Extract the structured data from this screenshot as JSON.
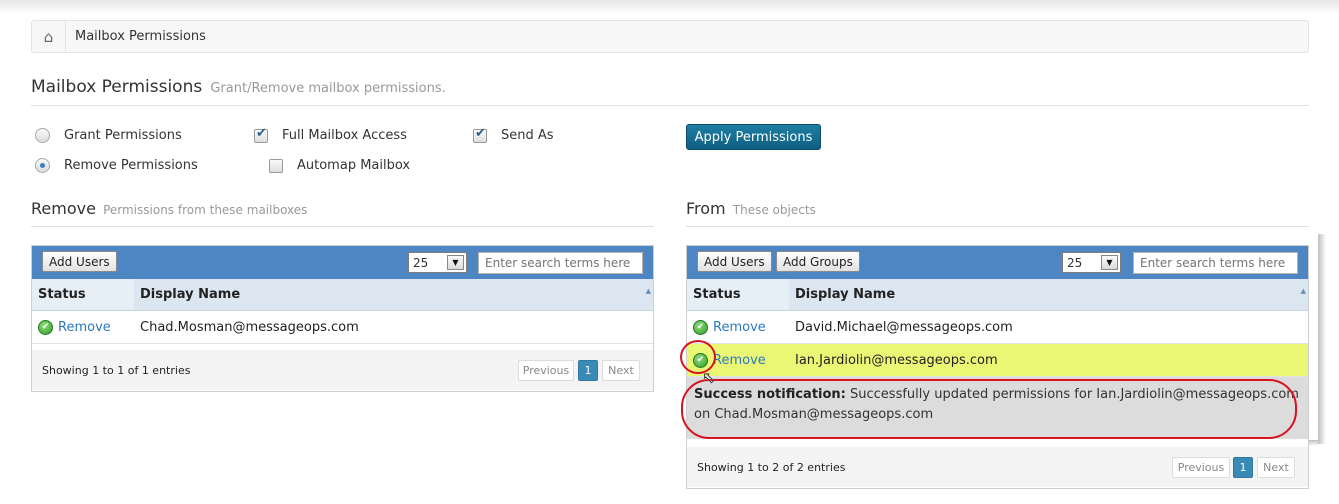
{
  "breadcrumb": {
    "home_icon": "home-icon",
    "current": "Mailbox Permissions"
  },
  "page": {
    "title": "Mailbox Permissions",
    "subtitle": "Grant/Remove mailbox permissions."
  },
  "options": {
    "grant_label": "Grant Permissions",
    "remove_label": "Remove Permissions",
    "full_access_label": "Full Mailbox Access",
    "automap_label": "Automap Mailbox",
    "send_as_label": "Send As",
    "selected_mode": "remove",
    "full_access_checked": true,
    "automap_checked": false,
    "send_as_checked": true
  },
  "apply_button": "Apply Permissions",
  "remove_section": {
    "title": "Remove",
    "subtitle": "Permissions from these mailboxes",
    "add_users": "Add Users",
    "page_size": "25",
    "search_placeholder": "Enter search terms here",
    "col_status": "Status",
    "col_name": "Display Name",
    "rows": [
      {
        "status": "Remove",
        "name": "Chad.Mosman@messageops.com"
      }
    ],
    "info": "Showing 1 to 1 of 1 entries",
    "prev": "Previous",
    "page": "1",
    "next": "Next"
  },
  "from_section": {
    "title": "From",
    "subtitle": "These objects",
    "add_users": "Add Users",
    "add_groups": "Add Groups",
    "page_size": "25",
    "search_placeholder": "Enter search terms here",
    "col_status": "Status",
    "col_name": "Display Name",
    "rows": [
      {
        "status": "Remove",
        "name": "David.Michael@messageops.com"
      },
      {
        "status": "Remove",
        "name": "Ian.Jardiolin@messageops.com"
      }
    ],
    "notification_label": "Success notification:",
    "notification_text": " Successfully updated permissions for Ian.Jardiolin@messageops.com on Chad.Mosman@messageops.com",
    "info": "Showing 1 to 2 of 2 entries",
    "prev": "Previous",
    "page": "1",
    "next": "Next"
  },
  "colors": {
    "toolbar": "#4d86c2",
    "highlight": "#eaf775",
    "annotation": "#d8121f",
    "link": "#2a7ac0"
  }
}
